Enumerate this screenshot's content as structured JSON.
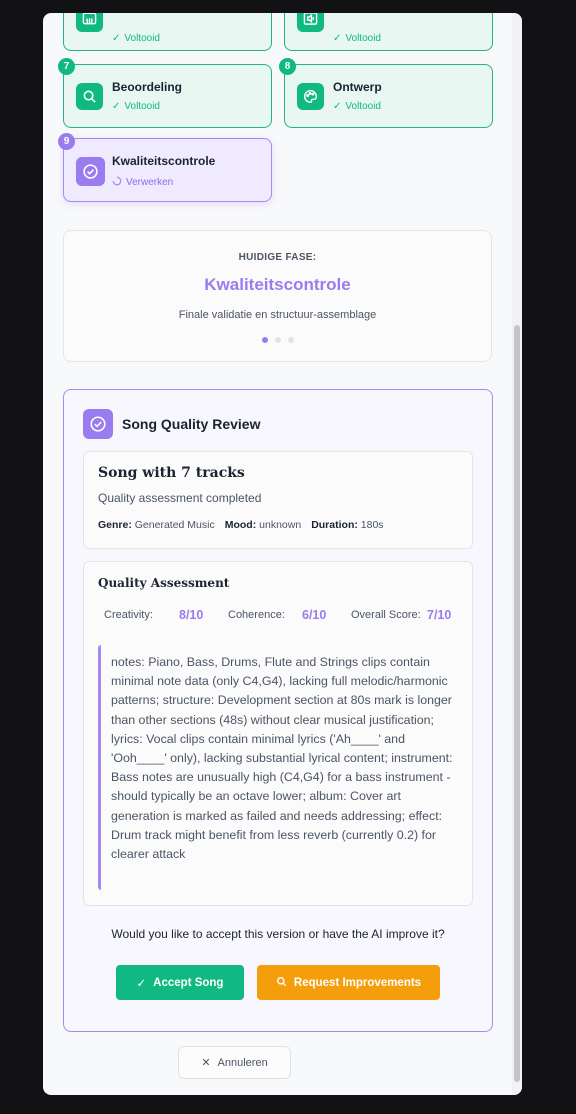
{
  "stages": [
    {
      "number": "",
      "title": "",
      "status": "Voltooid",
      "icon": "piano-icon"
    },
    {
      "number": "",
      "title": "",
      "status": "Voltooid",
      "icon": "speaker-icon"
    },
    {
      "number": "7",
      "title": "Beoordeling",
      "status": "Voltooid",
      "icon": "search-icon"
    },
    {
      "number": "8",
      "title": "Ontwerp",
      "status": "Voltooid",
      "icon": "palette-icon"
    },
    {
      "number": "9",
      "title": "Kwaliteitscontrole",
      "status": "Verwerken",
      "icon": "check-circle-icon"
    }
  ],
  "phase": {
    "label": "HUIDIGE FASE:",
    "name": "Kwaliteitscontrole",
    "description": "Finale validatie en structuur-assemblage",
    "dots_total": 3,
    "dots_active": 1
  },
  "review": {
    "title": "Song Quality Review",
    "song": {
      "title": "Song with 7 tracks",
      "subtitle": "Quality assessment completed",
      "genre_label": "Genre:",
      "genre": "Generated Music",
      "mood_label": "Mood:",
      "mood": "unknown",
      "duration_label": "Duration:",
      "duration": "180s"
    },
    "assessment": {
      "title": "Quality Assessment",
      "creativity_label": "Creativity:",
      "creativity": "8/10",
      "coherence_label": "Coherence:",
      "coherence": "6/10",
      "overall_label": "Overall Score:",
      "overall": "7/10",
      "notes": "notes: Piano, Bass, Drums, Flute and Strings clips contain minimal note data (only C4,G4), lacking full melodic/harmonic patterns; structure: Development section at 80s mark is longer than other sections (48s) without clear musical justification; lyrics: Vocal clips contain minimal lyrics ('Ah____' and 'Ooh____' only), lacking substantial lyrical content; instrument: Bass notes are unusually high (C4,G4) for a bass instrument - should typically be an octave lower; album: Cover art generation is marked as failed and needs addressing; effect: Drum track might benefit from less reverb (currently 0.2) for clearer attack"
    },
    "question": "Would you like to accept this version or have the AI improve it?",
    "accept_label": "Accept Song",
    "improve_label": "Request Improvements"
  },
  "cancel_label": "Annuleren",
  "colors": {
    "complete": "#10b981",
    "active": "#9b7bf0",
    "warning": "#f59e0b"
  }
}
